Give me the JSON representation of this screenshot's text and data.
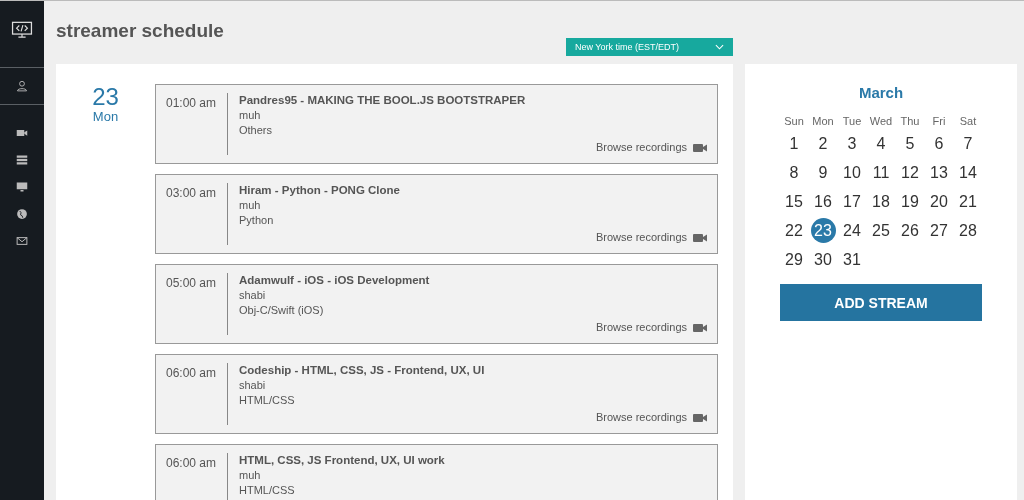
{
  "page_title": "streamer schedule",
  "timezone_dropdown": {
    "value": "New York time (EST/EDT)"
  },
  "day": {
    "number": "23",
    "weekday": "Mon"
  },
  "events": [
    {
      "time": "01:00 am",
      "title": "Pandres95 - MAKING THE BOOL.JS BOOTSTRAPER",
      "streamer": "muh",
      "category": "Others",
      "link": "Browse recordings"
    },
    {
      "time": "03:00 am",
      "title": "Hiram - Python - PONG Clone",
      "streamer": "muh",
      "category": "Python",
      "link": "Browse recordings"
    },
    {
      "time": "05:00 am",
      "title": "Adamwulf - iOS - iOS Development",
      "streamer": "shabi",
      "category": "Obj-C/Swift (iOS)",
      "link": "Browse recordings"
    },
    {
      "time": "06:00 am",
      "title": "Codeship - HTML, CSS, JS - Frontend, UX, UI",
      "streamer": "shabi",
      "category": "HTML/CSS",
      "link": "Browse recordings"
    },
    {
      "time": "06:00 am",
      "title": "HTML, CSS, JS Frontend, UX, UI work",
      "streamer": "muh",
      "category": "HTML/CSS"
    }
  ],
  "calendar": {
    "month": "March",
    "weekdays": [
      "Sun",
      "Mon",
      "Tue",
      "Wed",
      "Thu",
      "Fri",
      "Sat"
    ],
    "days": [
      {
        "label": "1",
        "selected": false
      },
      {
        "label": "2",
        "selected": false
      },
      {
        "label": "3",
        "selected": false
      },
      {
        "label": "4",
        "selected": false
      },
      {
        "label": "5",
        "selected": false
      },
      {
        "label": "6",
        "selected": false
      },
      {
        "label": "7",
        "selected": false
      },
      {
        "label": "8",
        "selected": false
      },
      {
        "label": "9",
        "selected": false
      },
      {
        "label": "10",
        "selected": false
      },
      {
        "label": "11",
        "selected": false
      },
      {
        "label": "12",
        "selected": false
      },
      {
        "label": "13",
        "selected": false
      },
      {
        "label": "14",
        "selected": false
      },
      {
        "label": "15",
        "selected": false
      },
      {
        "label": "16",
        "selected": false
      },
      {
        "label": "17",
        "selected": false
      },
      {
        "label": "18",
        "selected": false
      },
      {
        "label": "19",
        "selected": false
      },
      {
        "label": "20",
        "selected": false
      },
      {
        "label": "21",
        "selected": false
      },
      {
        "label": "22",
        "selected": false
      },
      {
        "label": "23",
        "selected": true
      },
      {
        "label": "24",
        "selected": false
      },
      {
        "label": "25",
        "selected": false
      },
      {
        "label": "26",
        "selected": false
      },
      {
        "label": "27",
        "selected": false
      },
      {
        "label": "28",
        "selected": false
      },
      {
        "label": "29",
        "selected": false
      },
      {
        "label": "30",
        "selected": false
      },
      {
        "label": "31",
        "selected": false
      }
    ]
  },
  "add_button": "ADD STREAM"
}
